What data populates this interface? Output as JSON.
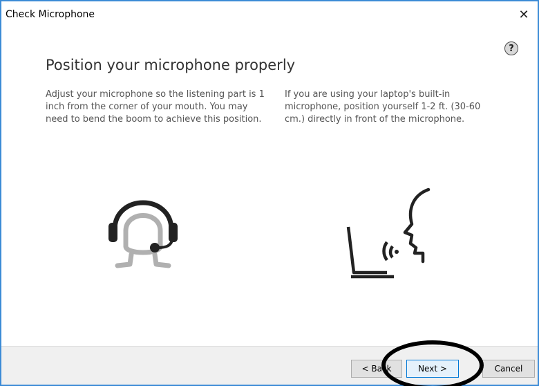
{
  "window": {
    "title": "Check Microphone",
    "close_glyph": "✕",
    "help_glyph": "?"
  },
  "content": {
    "heading": "Position your microphone properly",
    "left_text": "Adjust your microphone so the listening part is 1 inch from the corner of your mouth. You may need to bend the boom to achieve this position.",
    "right_text": "If you are using your laptop's built-in microphone, position yourself 1-2 ft. (30-60 cm.) directly in front of the microphone."
  },
  "footer": {
    "back_label": "< Back",
    "next_label": "Next >",
    "cancel_label": "Cancel"
  },
  "icons": {
    "headset": "headset-person-icon",
    "laptop": "laptop-speaking-icon"
  },
  "colors": {
    "window_border": "#3c8bd6",
    "icon_dark": "#222222",
    "icon_gray": "#b0b0b0",
    "focus_border": "#0078d7"
  }
}
